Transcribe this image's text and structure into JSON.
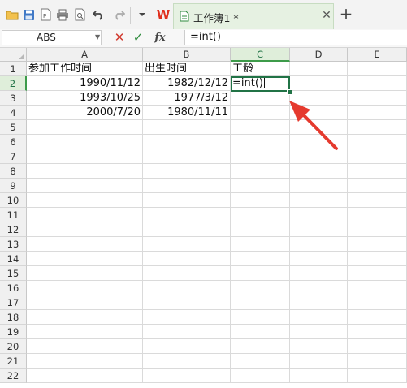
{
  "toolbar": {
    "wps_logo": "W",
    "tab_title": "工作簿1 *",
    "tab_close": "✕",
    "new_tab": "+"
  },
  "formula_bar": {
    "name_box": "ABS",
    "cancel": "✕",
    "confirm": "✓",
    "fx": "fx",
    "formula": "=int()"
  },
  "columns": [
    "A",
    "B",
    "C",
    "D",
    "E"
  ],
  "active_column": "C",
  "rows": [
    "1",
    "2",
    "3",
    "4",
    "5",
    "6",
    "7",
    "8",
    "9",
    "10",
    "11",
    "12",
    "13",
    "14",
    "15",
    "16",
    "17",
    "18",
    "19",
    "20",
    "21",
    "22"
  ],
  "active_row": "2",
  "cells": {
    "A1": "参加工作时间",
    "B1": "出生时间",
    "C1": "工龄",
    "A2": "1990/11/12",
    "B2": "1982/12/12",
    "C2": "=int()",
    "A3": "1993/10/25",
    "B3": "1977/3/12",
    "A4": "2000/7/20",
    "B4": "1980/11/11"
  },
  "colors": {
    "accent": "#217346",
    "annotation_arrow": "#e53a2e",
    "tab_background": "#e6f1e2"
  }
}
